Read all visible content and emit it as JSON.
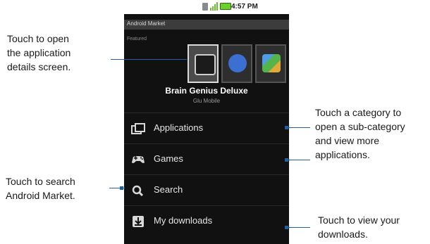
{
  "status_bar": {
    "time": "4:57 PM"
  },
  "app": {
    "title": "Android Market",
    "section": "Featured",
    "featured_app": {
      "name": "Brain Genius Deluxe",
      "developer": "Glu Mobile"
    }
  },
  "menu": [
    {
      "label": "Applications",
      "icon": "applications-icon"
    },
    {
      "label": "Games",
      "icon": "gamepad-icon"
    },
    {
      "label": "Search",
      "icon": "search-icon"
    },
    {
      "label": "My downloads",
      "icon": "download-icon"
    }
  ],
  "callouts": {
    "details": [
      "Touch to open",
      "the application",
      "details screen."
    ],
    "category": [
      "Touch a category to",
      "open a sub-category",
      "and view more",
      "applications."
    ],
    "search": [
      "Touch to search",
      "Android Market."
    ],
    "downloads": [
      "Touch to view your",
      "downloads."
    ]
  },
  "colors": {
    "accent": "#1f5fa8",
    "screen_bg": "#111111",
    "battery": "#6bd02a"
  }
}
